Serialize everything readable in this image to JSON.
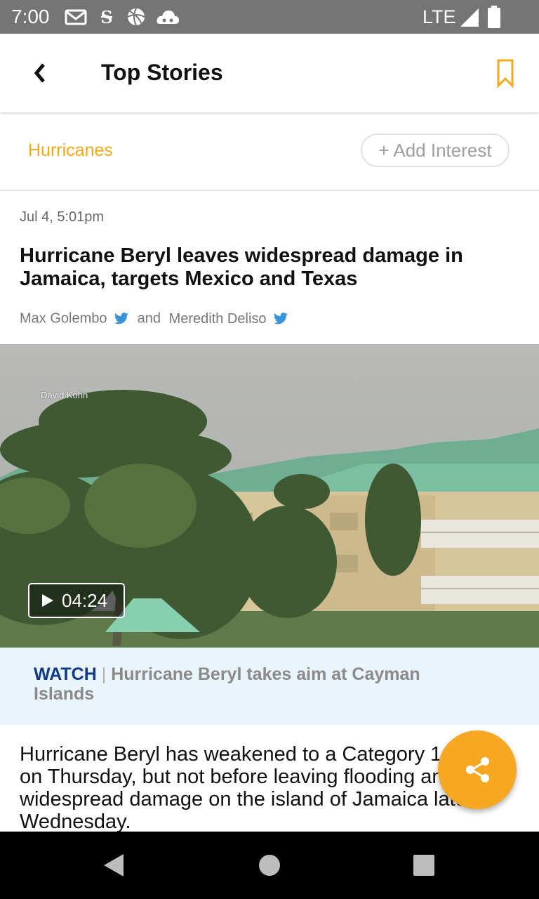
{
  "status_bar": {
    "time": "7:00",
    "icons": [
      "gmail-icon",
      "nyt-icon",
      "sports-ball-icon",
      "cloud-icon"
    ],
    "network": "LTE",
    "signal_icon": "signal-icon",
    "battery_icon": "battery-icon",
    "background": "#757575"
  },
  "app_bar": {
    "back_icon": "back-chevron-icon",
    "title": "Top Stories",
    "bookmark_icon": "bookmark-icon",
    "accent": "#f2a91c"
  },
  "interests": {
    "active": "Hurricanes",
    "add_label": "+ Add Interest"
  },
  "article": {
    "date": "Jul 4, 5:01pm",
    "headline": "Hurricane Beryl leaves widespread damage in Jamaica, targets Mexico and Texas",
    "authors": [
      "Max Golembo",
      "Meredith Deliso"
    ],
    "author_joiner": "and",
    "author_icon": "twitter-icon"
  },
  "video": {
    "credit": "David Kohn",
    "duration": "04:24",
    "play_icon": "play-icon",
    "caption_prefix": "WATCH",
    "caption_separator": "|",
    "caption_title": "Hurricane Beryl takes aim at Cayman Islands"
  },
  "body": {
    "text": "Hurricane Beryl has weakened to a Category 1 storm on Thursday, but not before leaving flooding and widespread damage on the island of Jamaica late Wednesday."
  },
  "share_button": {
    "icon": "share-icon",
    "color": "#f7a823"
  },
  "nav_bar": {
    "back_icon": "nav-back-icon",
    "home_icon": "nav-home-icon",
    "recents_icon": "nav-recents-icon"
  }
}
